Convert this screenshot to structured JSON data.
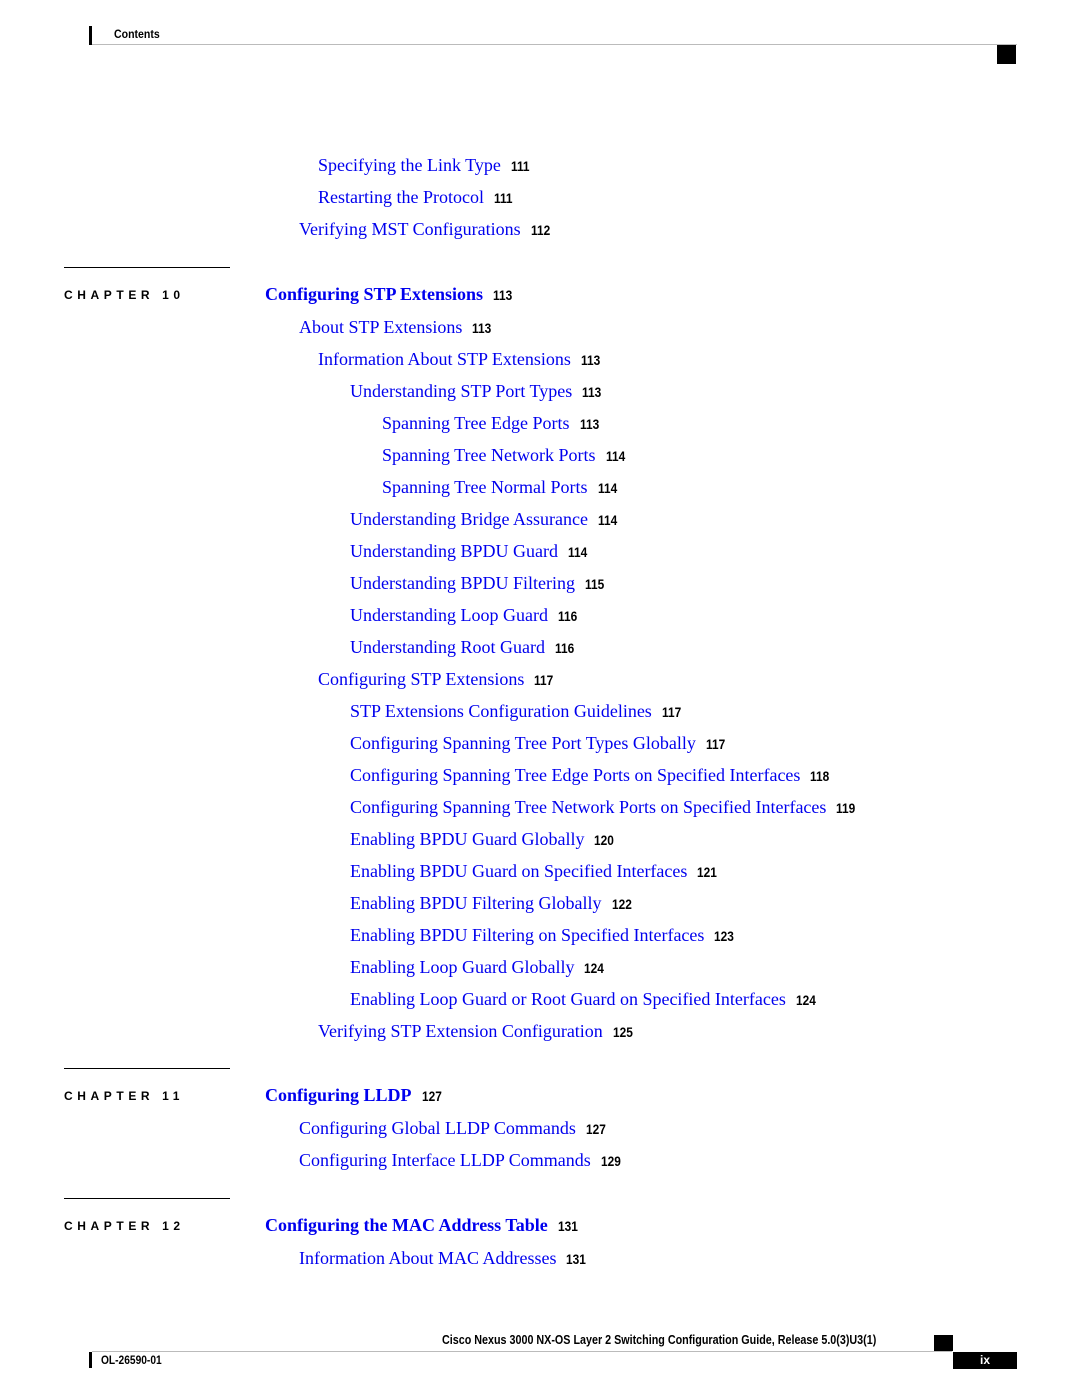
{
  "header": {
    "title": "Contents"
  },
  "toc": {
    "pre": [
      {
        "label": "Specifying the Link Type",
        "page": "111"
      },
      {
        "label": "Restarting the Protocol",
        "page": "111"
      },
      {
        "label": "Verifying MST Configurations",
        "page": "112"
      }
    ],
    "chapters": [
      {
        "chapter_label": "CHAPTER 10",
        "title": "Configuring STP Extensions",
        "page": "113",
        "entries": [
          {
            "label": "About STP Extensions",
            "page": "113"
          },
          {
            "label": "Information About STP Extensions",
            "page": "113"
          },
          {
            "label": "Understanding STP Port Types",
            "page": "113"
          },
          {
            "label": "Spanning Tree Edge Ports",
            "page": "113"
          },
          {
            "label": "Spanning Tree Network Ports",
            "page": "114"
          },
          {
            "label": "Spanning Tree Normal Ports",
            "page": "114"
          },
          {
            "label": "Understanding Bridge Assurance",
            "page": "114"
          },
          {
            "label": "Understanding BPDU Guard",
            "page": "114"
          },
          {
            "label": "Understanding BPDU Filtering",
            "page": "115"
          },
          {
            "label": "Understanding Loop Guard",
            "page": "116"
          },
          {
            "label": "Understanding Root Guard",
            "page": "116"
          },
          {
            "label": "Configuring STP Extensions",
            "page": "117"
          },
          {
            "label": "STP Extensions Configuration Guidelines",
            "page": "117"
          },
          {
            "label": "Configuring Spanning Tree Port Types Globally",
            "page": "117"
          },
          {
            "label": "Configuring Spanning Tree Edge Ports on Specified Interfaces",
            "page": "118"
          },
          {
            "label": "Configuring Spanning Tree Network Ports on Specified Interfaces",
            "page": "119"
          },
          {
            "label": "Enabling BPDU Guard Globally",
            "page": "120"
          },
          {
            "label": "Enabling BPDU Guard on Specified Interfaces",
            "page": "121"
          },
          {
            "label": "Enabling BPDU Filtering Globally",
            "page": "122"
          },
          {
            "label": "Enabling BPDU Filtering on Specified Interfaces",
            "page": "123"
          },
          {
            "label": "Enabling Loop Guard Globally",
            "page": "124"
          },
          {
            "label": "Enabling Loop Guard or Root Guard on Specified Interfaces",
            "page": "124"
          },
          {
            "label": "Verifying STP Extension Configuration",
            "page": "125"
          }
        ]
      },
      {
        "chapter_label": "CHAPTER 11",
        "title": "Configuring LLDP",
        "page": "127",
        "entries": [
          {
            "label": "Configuring Global LLDP Commands",
            "page": "127"
          },
          {
            "label": "Configuring Interface LLDP Commands",
            "page": "129"
          }
        ]
      },
      {
        "chapter_label": "CHAPTER 12",
        "title": "Configuring the MAC Address Table",
        "page": "131",
        "entries": [
          {
            "label": "Information About MAC Addresses",
            "page": "131"
          }
        ]
      }
    ]
  },
  "footer": {
    "guide_title": "Cisco Nexus 3000 NX-OS Layer 2 Switching Configuration Guide, Release 5.0(3)U3(1)",
    "doc_number": "OL-26590-01",
    "page_number": "ix"
  },
  "colors": {
    "link": "#0000ee",
    "text": "#000000",
    "rule": "#bbbbbb"
  }
}
